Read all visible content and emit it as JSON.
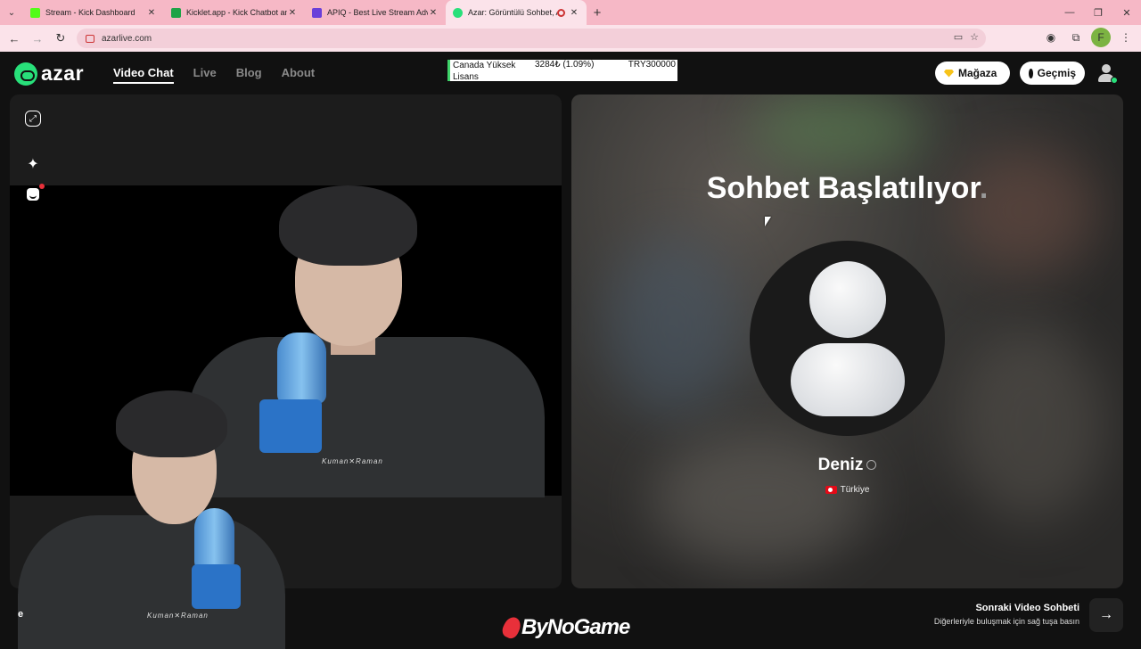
{
  "browser": {
    "tabs": [
      {
        "title": "Stream - Kick Dashboard",
        "favicon_color": "#53fc18",
        "active": false
      },
      {
        "title": "Kicklet.app - Kick Chatbot and (",
        "favicon_color": "#1fa347",
        "active": false
      },
      {
        "title": "APIQ - Best Live Stream Adverti",
        "favicon_color": "#6a3fd9",
        "active": false
      },
      {
        "title": "Azar: Görüntülü Sohbet, Ar",
        "favicon_color": "#28e07a",
        "active": true
      }
    ],
    "new_tab": "+",
    "url": "azarlive.com",
    "profile_initial": "F"
  },
  "header": {
    "logo_text": "azar",
    "nav": [
      {
        "label": "Video Chat",
        "active": true
      },
      {
        "label": "Live",
        "active": false
      },
      {
        "label": "Blog",
        "active": false
      },
      {
        "label": "About",
        "active": false
      }
    ],
    "ticker": {
      "name": "Canada Yüksek Lisans",
      "change": "3284₺ (1.09%)",
      "amount": "TRY300000"
    },
    "store_label": "Mağaza",
    "history_label": "Geçmiş"
  },
  "partner": {
    "status": "Sohbet Başlatılıyor",
    "status_dot": ".",
    "name": "Deniz",
    "country": "Türkiye"
  },
  "footer": {
    "left_text": "e",
    "sponsor": "ByNoGame",
    "next_title": "Sonraki Video Sohbeti",
    "next_subtitle": "Diğerleriyle buluşmak için sağ tuşa basın"
  },
  "colors": {
    "brand_green": "#28e07a",
    "tab_bar": "#f6b8c6",
    "notification_red": "#e8303a"
  }
}
